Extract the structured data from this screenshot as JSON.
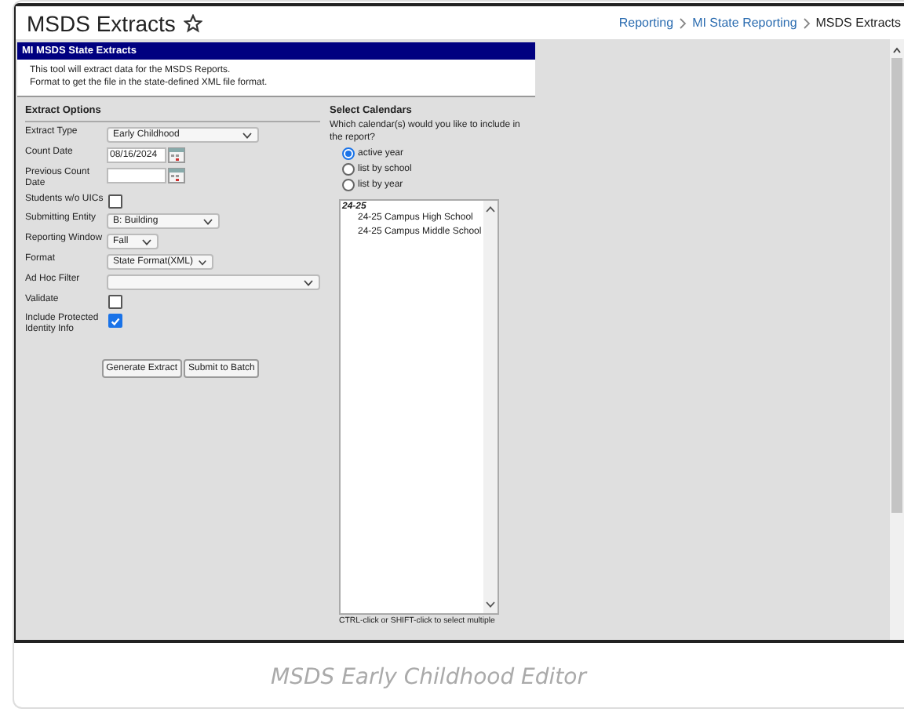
{
  "header": {
    "title": "MSDS Extracts",
    "favorite": false,
    "breadcrumbs": [
      {
        "label": "Reporting",
        "kind": "link"
      },
      {
        "label": "MI State Reporting",
        "kind": "link"
      },
      {
        "label": "MSDS Extracts",
        "kind": "current"
      }
    ]
  },
  "tool": {
    "title": "MI MSDS State Extracts",
    "description": [
      "This tool will extract data for the MSDS Reports.",
      "Format to get the file in the state-defined XML file format."
    ]
  },
  "extract_options": {
    "heading": "Extract Options",
    "fields": [
      {
        "label": "Extract Type",
        "kind": "select",
        "value": "Early Childhood"
      },
      {
        "label": "Count Date",
        "kind": "date",
        "value": "08/16/2024"
      },
      {
        "label": "Previous Count Date",
        "kind": "date"
      },
      {
        "label": "Students w/o UICs",
        "kind": "checkbox",
        "checked": false
      },
      {
        "label": "Submitting Entity",
        "kind": "select",
        "value": "B: Building"
      },
      {
        "label": "Reporting Window",
        "kind": "select",
        "value": "Fall"
      },
      {
        "label": "Format",
        "kind": "select",
        "value": "State Format(XML)"
      },
      {
        "label": "Ad Hoc Filter",
        "kind": "select"
      },
      {
        "label": "Validate",
        "kind": "checkbox",
        "checked": false
      },
      {
        "label": "Include Protected Identity Info",
        "kind": "checkbox",
        "checked": true
      }
    ],
    "buttons": [
      "Generate Extract",
      "Submit to Batch"
    ]
  },
  "select_calendars": {
    "heading": "Select Calendars",
    "question": "Which calendar(s) would you like to include in the report?",
    "options": [
      {
        "label": "active year",
        "selected": true
      },
      {
        "label": "list by school",
        "selected": false
      },
      {
        "label": "list by year",
        "selected": false
      }
    ],
    "calendars": [
      {
        "label": "24-25",
        "children": [
          {
            "label": "24-25 Campus High School"
          },
          {
            "label": "24-25 Campus Middle School"
          }
        ]
      }
    ],
    "hint": "CTRL-click or SHIFT-click to select multiple"
  },
  "caption": "MSDS Early Childhood Editor"
}
